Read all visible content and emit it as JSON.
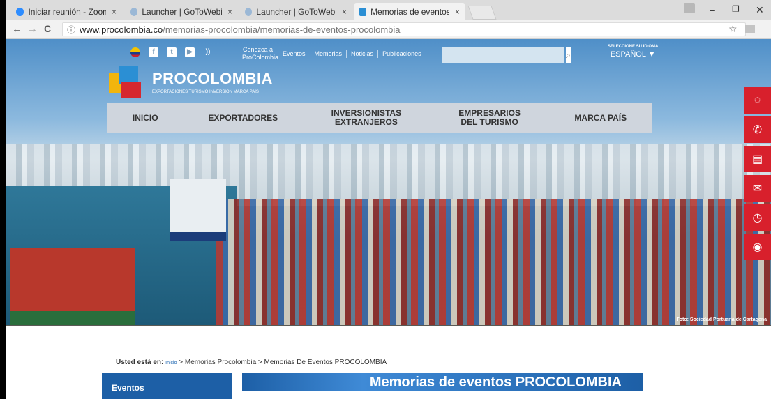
{
  "browser": {
    "tabs": [
      {
        "title": "Iniciar reunión - Zoom",
        "active": false
      },
      {
        "title": "Launcher | GoToWebinar",
        "active": false
      },
      {
        "title": "Launcher | GoToWebinar",
        "active": false
      },
      {
        "title": "Memorias de eventos PR",
        "active": true
      }
    ],
    "close_glyph": "×",
    "url_domain": "www.procolombia.co",
    "url_path": "/memorias-procolombia/memorias-de-eventos-procolombia",
    "info_glyph": "ⓘ",
    "star_glyph": "☆",
    "back_glyph": "←",
    "forward_glyph": "→",
    "reload_glyph": "C",
    "minimize_glyph": "–",
    "restore_glyph": "❐",
    "window_close_glyph": "✕"
  },
  "site": {
    "social_icons": [
      "flag-icon",
      "facebook-icon",
      "twitter-icon",
      "youtube-icon",
      "rss-icon"
    ],
    "social_glyphs": [
      "f",
      "t",
      "▶",
      "))"
    ],
    "top_links": [
      "Conozca a ProColombia",
      "Eventos",
      "Memorias",
      "Noticias",
      "Publicaciones"
    ],
    "search_glyph": "⌕",
    "language_label": "SELECCIONE SU IDIOMA",
    "language_value": "ESPAÑOL ▼",
    "logo_name": "PROCOLOMBIA",
    "logo_tagline": "EXPORTACIONES TURISMO INVERSIÓN MARCA PAÍS",
    "main_nav": [
      "INICIO",
      "EXPORTADORES",
      "INVERSIONISTAS EXTRANJEROS",
      "EMPRESARIOS DEL TURISMO",
      "MARCA PAÍS"
    ],
    "side_buttons": [
      "chat-icon",
      "phone-icon",
      "contact-card-icon",
      "mail-icon",
      "clock-icon",
      "location-icon"
    ],
    "side_glyphs": [
      "◌",
      "✆",
      "▤",
      "✉",
      "◷",
      "◉"
    ],
    "photo_credit": "Foto: Sociedad Portuaria de Cartagena"
  },
  "content": {
    "breadcrumb_lead": "Usted está en:",
    "breadcrumb_home": "Inicio",
    "breadcrumb_rest": " > Memorias Procolombia > Memorias De Eventos PROCOLOMBIA",
    "sidebar_title": "Eventos",
    "banner_title": "Memorias de eventos PROCOLOMBIA"
  },
  "colors": {
    "brand_red": "#d8202c",
    "brand_blue": "#1d5fa6",
    "nav_bg": "#cfd5dd"
  }
}
